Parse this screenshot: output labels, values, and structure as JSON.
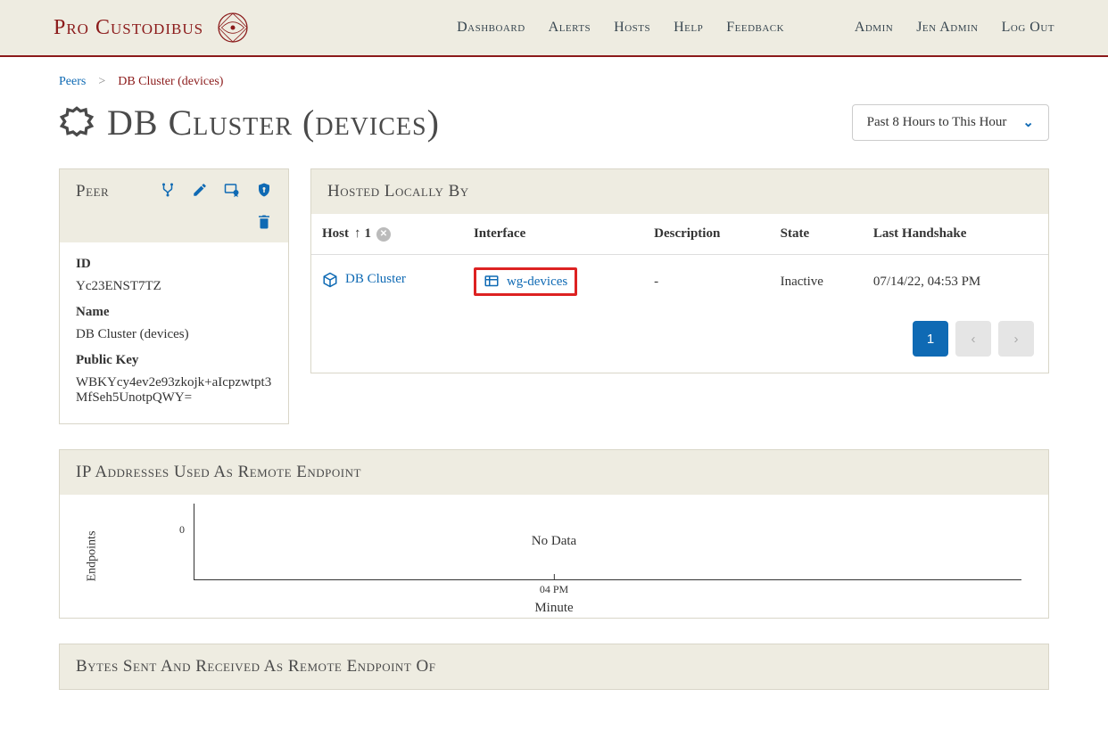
{
  "brand": "Pro Custodibus",
  "nav": {
    "primary": [
      "Dashboard",
      "Alerts",
      "Hosts",
      "Help",
      "Feedback"
    ],
    "secondary": [
      "Admin",
      "Jen Admin",
      "Log Out"
    ]
  },
  "breadcrumb": {
    "root": "Peers",
    "current": "DB Cluster (devices)"
  },
  "page_title": "DB Cluster (devices)",
  "time_range": "Past 8 Hours to This Hour",
  "peer": {
    "header": "Peer",
    "id_label": "ID",
    "id": "Yc23ENST7TZ",
    "name_label": "Name",
    "name": "DB Cluster (devices)",
    "pubkey_label": "Public Key",
    "pubkey": "WBKYcy4ev2e93zkojk+aIcpzwtpt3MfSeh5UnotpQWY="
  },
  "hosted": {
    "header": "Hosted Locally By",
    "columns": {
      "host": "Host",
      "sort_num": "1",
      "interface": "Interface",
      "description": "Description",
      "state": "State",
      "last_handshake": "Last Handshake"
    },
    "rows": [
      {
        "host": "DB Cluster",
        "interface": "wg-devices",
        "description": "-",
        "state": "Inactive",
        "last_handshake": "07/14/22, 04:53 PM"
      }
    ],
    "page": "1"
  },
  "chart1_header": "IP Addresses Used As Remote Endpoint",
  "chart2_header": "Bytes Sent And Received As Remote Endpoint Of",
  "chart_data": {
    "type": "line",
    "title": "IP Addresses Used As Remote Endpoint",
    "xlabel": "Minute",
    "ylabel": "Endpoints",
    "x": [],
    "y": [],
    "no_data_message": "No Data",
    "x_tick_labels": [
      "04 PM"
    ],
    "y_tick_labels": [
      "0"
    ],
    "ylim": [
      0,
      0
    ]
  }
}
